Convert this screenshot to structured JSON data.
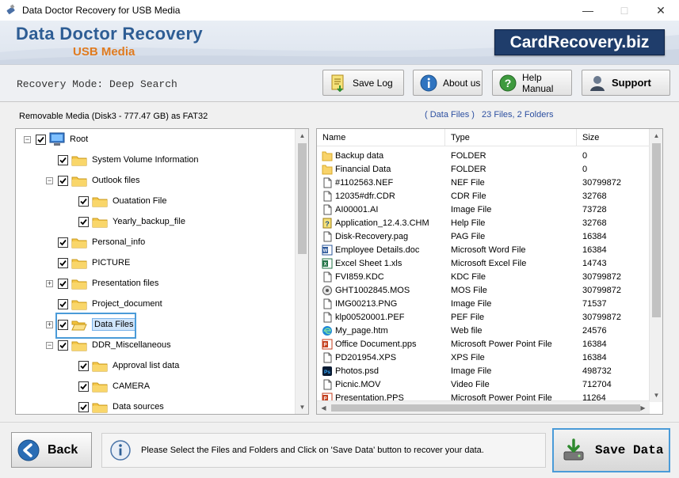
{
  "window": {
    "title": "Data Doctor Recovery for USB Media",
    "controls": [
      "minimize",
      "maximize",
      "close"
    ]
  },
  "header": {
    "product_name": "Data Doctor Recovery",
    "product_sub": "USB Media",
    "brand": "CardRecovery.biz"
  },
  "toolbar": {
    "mode_label": "Recovery Mode: Deep Search",
    "save_log": "Save Log",
    "about_us": "About us",
    "help_manual": "Help Manual",
    "support": "Support"
  },
  "info": {
    "drive": "Removable Media (Disk3 - 777.47 GB) as FAT32",
    "current_folder": "( Data Files )",
    "counts": "23 Files, 2 Folders"
  },
  "tree": [
    {
      "label": "Root",
      "icon": "computer-icon",
      "expander": "minus"
    },
    {
      "label": "System Volume Information",
      "icon": "folder-icon",
      "expander": "none"
    },
    {
      "label": "Outlook files",
      "icon": "folder-icon",
      "expander": "minus"
    },
    {
      "label": "Ouatation File",
      "icon": "folder-icon",
      "expander": "none"
    },
    {
      "label": "Yearly_backup_file",
      "icon": "folder-icon",
      "expander": "none"
    },
    {
      "label": "Personal_info",
      "icon": "folder-icon",
      "expander": "none"
    },
    {
      "label": "PICTURE",
      "icon": "folder-icon",
      "expander": "none"
    },
    {
      "label": "Presentation files",
      "icon": "folder-icon",
      "expander": "plus"
    },
    {
      "label": "Project_document",
      "icon": "folder-icon",
      "expander": "none"
    },
    {
      "label": "Data Files",
      "icon": "open-folder-icon",
      "expander": "plus",
      "selected": true
    },
    {
      "label": "DDR_Miscellaneous",
      "icon": "folder-icon",
      "expander": "minus"
    },
    {
      "label": "Approval list data",
      "icon": "folder-icon",
      "expander": "none"
    },
    {
      "label": "CAMERA",
      "icon": "folder-icon",
      "expander": "none"
    },
    {
      "label": "Data sources",
      "icon": "folder-icon",
      "expander": "none"
    }
  ],
  "file_list": {
    "columns": [
      "Name",
      "Type",
      "Size"
    ],
    "rows": [
      {
        "name": "Backup data",
        "type": "FOLDER",
        "size": "0",
        "icon": "folder-icon"
      },
      {
        "name": "Financial Data",
        "type": "FOLDER",
        "size": "0",
        "icon": "folder-icon"
      },
      {
        "name": "#1102563.NEF",
        "type": "NEF File",
        "size": "30799872",
        "icon": "file-icon"
      },
      {
        "name": "12035#dfr.CDR",
        "type": "CDR File",
        "size": "32768",
        "icon": "file-icon"
      },
      {
        "name": "AI00001.AI",
        "type": "Image File",
        "size": "73728",
        "icon": "file-icon"
      },
      {
        "name": "Application_12.4.3.CHM",
        "type": "Help File",
        "size": "32768",
        "icon": "help-file-icon"
      },
      {
        "name": "Disk-Recovery.pag",
        "type": "PAG File",
        "size": "16384",
        "icon": "file-icon"
      },
      {
        "name": "Employee Details.doc",
        "type": "Microsoft Word File",
        "size": "16384",
        "icon": "word-icon"
      },
      {
        "name": "Excel Sheet 1.xls",
        "type": "Microsoft Excel File",
        "size": "14743",
        "icon": "excel-icon"
      },
      {
        "name": "FVI859.KDC",
        "type": "KDC File",
        "size": "30799872",
        "icon": "file-icon"
      },
      {
        "name": "GHT1002845.MOS",
        "type": "MOS File",
        "size": "30799872",
        "icon": "mos-icon"
      },
      {
        "name": "IMG00213.PNG",
        "type": "Image File",
        "size": "71537",
        "icon": "file-icon"
      },
      {
        "name": "klp00520001.PEF",
        "type": "PEF File",
        "size": "30799872",
        "icon": "file-icon"
      },
      {
        "name": "My_page.htm",
        "type": "Web file",
        "size": "24576",
        "icon": "edge-icon"
      },
      {
        "name": "Office Document.pps",
        "type": "Microsoft Power Point File",
        "size": "16384",
        "icon": "powerpoint-icon"
      },
      {
        "name": "PD201954.XPS",
        "type": "XPS File",
        "size": "16384",
        "icon": "file-icon"
      },
      {
        "name": "Photos.psd",
        "type": "Image File",
        "size": "498732",
        "icon": "photoshop-icon"
      },
      {
        "name": "Picnic.MOV",
        "type": "Video File",
        "size": "712704",
        "icon": "file-icon"
      },
      {
        "name": "Presentation.PPS",
        "type": "Microsoft Power Point File",
        "size": "11264",
        "icon": "powerpoint-icon"
      }
    ]
  },
  "bottom": {
    "back": "Back",
    "message": "Please Select the Files and Folders and Click on 'Save Data' button to recover your data.",
    "save_data": "Save Data"
  },
  "colors": {
    "title_blue": "#2e5d94",
    "subtitle_orange": "#e07b1f",
    "brand_bg": "#1f3d6b",
    "focus_blue": "#4a9bd8",
    "info_text": "#2c4fa0"
  }
}
